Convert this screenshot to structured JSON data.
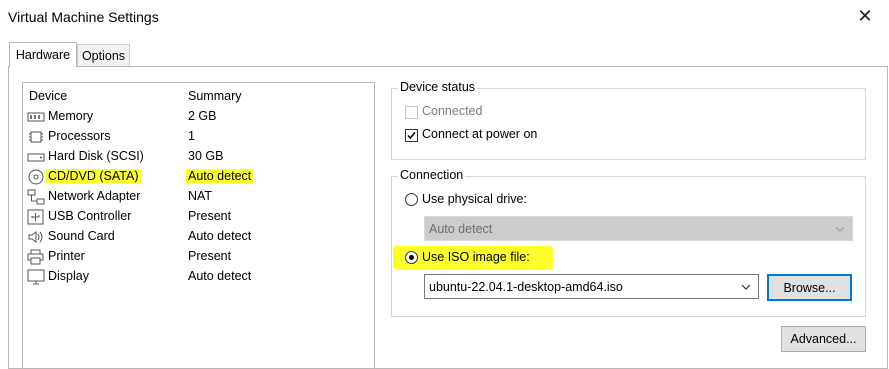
{
  "window": {
    "title": "Virtual Machine Settings",
    "close_glyph": "✕"
  },
  "tabs": [
    {
      "label": "Hardware"
    },
    {
      "label": "Options"
    }
  ],
  "device_list": {
    "columns": {
      "device": "Device",
      "summary": "Summary"
    },
    "items": [
      {
        "name": "Memory",
        "summary": "2 GB",
        "icon": "memory-icon"
      },
      {
        "name": "Processors",
        "summary": "1",
        "icon": "processor-icon"
      },
      {
        "name": "Hard Disk (SCSI)",
        "summary": "30 GB",
        "icon": "hard-disk-icon"
      },
      {
        "name": "CD/DVD (SATA)",
        "summary": "Auto detect",
        "icon": "cd-dvd-icon",
        "highlighted": true
      },
      {
        "name": "Network Adapter",
        "summary": "NAT",
        "icon": "network-adapter-icon"
      },
      {
        "name": "USB Controller",
        "summary": "Present",
        "icon": "usb-icon"
      },
      {
        "name": "Sound Card",
        "summary": "Auto detect",
        "icon": "speaker-icon"
      },
      {
        "name": "Printer",
        "summary": "Present",
        "icon": "printer-icon"
      },
      {
        "name": "Display",
        "summary": "Auto detect",
        "icon": "display-icon"
      }
    ]
  },
  "device_status": {
    "label": "Device status",
    "connected": {
      "label": "Connected",
      "checked": false,
      "enabled": false
    },
    "connect_at_power_on": {
      "label": "Connect at power on",
      "checked": true
    }
  },
  "connection": {
    "label": "Connection",
    "physical_drive": {
      "label": "Use physical drive:",
      "selected": false,
      "value": "Auto detect"
    },
    "iso_image": {
      "label": "Use ISO image file:",
      "selected": true,
      "value": "ubuntu-22.04.1-desktop-amd64.iso",
      "browse_label": "Browse..."
    }
  },
  "advanced_label": "Advanced...",
  "colors": {
    "highlight": "#ffff2a",
    "focus": "#0078d7"
  }
}
